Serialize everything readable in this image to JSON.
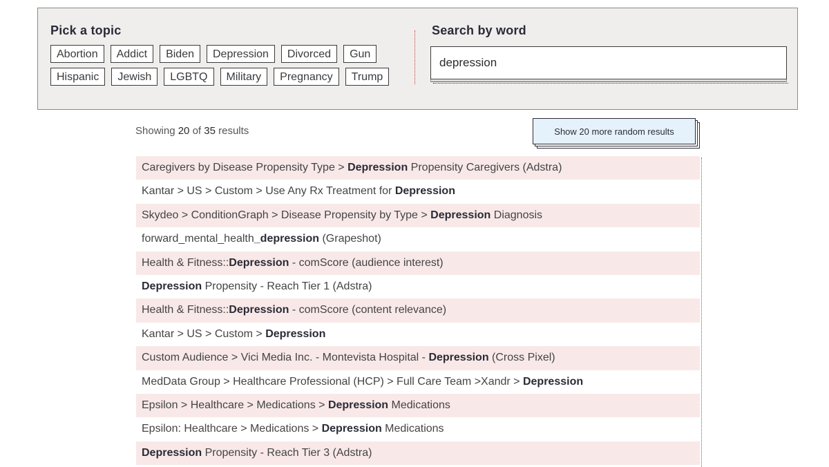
{
  "topics": {
    "title": "Pick a topic",
    "row1": [
      "Abortion",
      "Addict",
      "Biden",
      "Depression",
      "Divorced",
      "Gun"
    ],
    "row2": [
      "Hispanic",
      "Jewish",
      "LGBTQ",
      "Military",
      "Pregnancy",
      "Trump"
    ]
  },
  "search": {
    "title": "Search by word",
    "value": "depression"
  },
  "summary": {
    "prefix": "Showing ",
    "shown": "20",
    "middle": " of ",
    "total": "35",
    "suffix": " results"
  },
  "more_button_label": "Show 20 more random results",
  "results": [
    [
      [
        "Caregivers by Disease Propensity Type > ",
        false
      ],
      [
        "Depression",
        true
      ],
      [
        " Propensity Caregivers (Adstra)",
        false
      ]
    ],
    [
      [
        "Kantar > US > Custom > Use Any Rx Treatment for ",
        false
      ],
      [
        "Depression",
        true
      ]
    ],
    [
      [
        "Skydeo > ConditionGraph > Disease Propensity by Type > ",
        false
      ],
      [
        "Depression",
        true
      ],
      [
        " Diagnosis",
        false
      ]
    ],
    [
      [
        "forward_mental_health",
        false
      ],
      [
        "_depression",
        true
      ],
      [
        " (Grapeshot)",
        false
      ]
    ],
    [
      [
        "Health & Fitness::",
        false
      ],
      [
        "Depression",
        true
      ],
      [
        " - comScore (audience interest)",
        false
      ]
    ],
    [
      [
        "Depression",
        true
      ],
      [
        " Propensity - Reach Tier 1 (Adstra)",
        false
      ]
    ],
    [
      [
        "Health & Fitness::",
        false
      ],
      [
        "Depression",
        true
      ],
      [
        " - comScore (content relevance)",
        false
      ]
    ],
    [
      [
        "Kantar > US > Custom > ",
        false
      ],
      [
        "Depression",
        true
      ]
    ],
    [
      [
        "Custom Audience > Vici Media Inc. - Montevista Hospital - ",
        false
      ],
      [
        "Depression",
        true
      ],
      [
        " (Cross Pixel)",
        false
      ]
    ],
    [
      [
        "MedData Group > Healthcare Professional (HCP) > Full Care Team >Xandr > ",
        false
      ],
      [
        "Depression",
        true
      ]
    ],
    [
      [
        "Epsilon > Healthcare > Medications > ",
        false
      ],
      [
        "Depression",
        true
      ],
      [
        " Medications",
        false
      ]
    ],
    [
      [
        "Epsilon: Healthcare > Medications > ",
        false
      ],
      [
        "Depression",
        true
      ],
      [
        " Medications",
        false
      ]
    ],
    [
      [
        "Depression",
        true
      ],
      [
        " Propensity - Reach Tier 3 (Adstra)",
        false
      ]
    ]
  ]
}
